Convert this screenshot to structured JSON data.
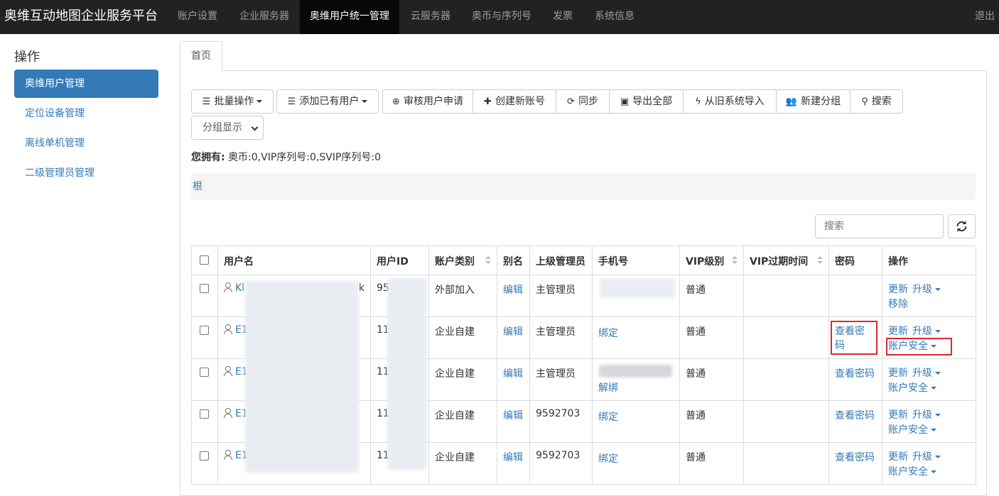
{
  "app_title": "奥维互动地图企业服务平台",
  "nav": {
    "items": [
      {
        "label": "账户设置"
      },
      {
        "label": "企业服务器"
      },
      {
        "label": "奥维用户统一管理"
      },
      {
        "label": "云服务器"
      },
      {
        "label": "奥币与序列号"
      },
      {
        "label": "发票"
      },
      {
        "label": "系统信息"
      }
    ],
    "active": "奥维用户统一管理",
    "logout": "退出"
  },
  "sidebar": {
    "title": "操作",
    "items": [
      {
        "label": "奥维用户管理"
      },
      {
        "label": "定位设备管理"
      },
      {
        "label": "离线单机管理"
      },
      {
        "label": "二级管理员管理"
      }
    ]
  },
  "tabs": [
    {
      "label": "首页"
    }
  ],
  "toolbar": {
    "batch": "批量操作",
    "add_existing": "添加已有用户",
    "review": "审核用户申请",
    "create": "创建新账号",
    "sync": "同步",
    "export": "导出全部",
    "import_old": "从旧系统导入",
    "new_group": "新建分组",
    "search": "搜索",
    "group_display": "分组显示"
  },
  "owned": {
    "label": "您拥有:",
    "value": "奥币:0,VIP序列号:0,SVIP序列号:0"
  },
  "breadcrumb": {
    "root": "根"
  },
  "table_search": {
    "placeholder": "搜索"
  },
  "table": {
    "headers": [
      "用户名",
      "用户ID",
      "账户类别",
      "别名",
      "上级管理员",
      "手机号",
      "VIP级别",
      "VIP过期时间",
      "密码",
      "操作"
    ],
    "rows": [
      {
        "username": "Kl",
        "username_tail": "k",
        "userid": "95",
        "type": "外部加入",
        "alias": "编辑",
        "manager": "主管理员",
        "phone": "",
        "phone_action": "",
        "vip": "普通",
        "vip_expire": "",
        "password": "",
        "op1": "更新",
        "op2": "升级",
        "op3": "移除"
      },
      {
        "username": "E1",
        "username_tail": "",
        "userid": "11",
        "type": "企业自建",
        "alias": "编辑",
        "manager": "主管理员",
        "phone": "",
        "phone_action": "绑定",
        "vip": "普通",
        "vip_expire": "",
        "password": "查看密码",
        "op1": "更新",
        "op2": "升级",
        "op3": "账户安全"
      },
      {
        "username": "E1",
        "username_tail": "",
        "userid": "11",
        "type": "企业自建",
        "alias": "编辑",
        "manager": "主管理员",
        "phone": "",
        "phone_action": "解绑",
        "vip": "普通",
        "vip_expire": "",
        "password": "查看密码",
        "op1": "更新",
        "op2": "升级",
        "op3": "账户安全"
      },
      {
        "username": "E1",
        "username_tail": "",
        "userid": "11",
        "type": "企业自建",
        "alias": "编辑",
        "manager": "9592703",
        "phone": "",
        "phone_action": "绑定",
        "vip": "普通",
        "vip_expire": "",
        "password": "查看密码",
        "op1": "更新",
        "op2": "升级",
        "op3": "账户安全"
      },
      {
        "username": "E1",
        "username_tail": "",
        "userid": "11",
        "type": "企业自建",
        "alias": "编辑",
        "manager": "9592703",
        "phone": "",
        "phone_action": "绑定",
        "vip": "普通",
        "vip_expire": "",
        "password": "查看密码",
        "op1": "更新",
        "op2": "升级",
        "op3": "账户安全"
      }
    ]
  },
  "colors": {
    "navbar": "#222222",
    "accent": "#337ab7",
    "highlight": "#e0282e",
    "external": "#e02020"
  }
}
